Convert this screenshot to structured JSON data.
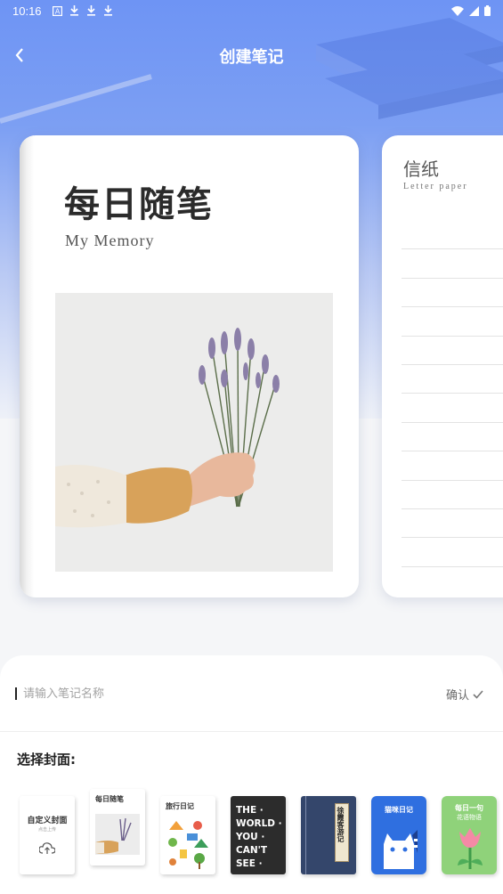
{
  "status_bar": {
    "time": "10:16",
    "left_icons": [
      "font-icon",
      "download-icon",
      "download-icon",
      "download-icon"
    ],
    "right_icons": [
      "wifi-icon",
      "signal-icon",
      "battery-icon"
    ]
  },
  "nav": {
    "title": "创建笔记",
    "back_icon": "chevron-left-icon"
  },
  "carousel": {
    "main_card": {
      "title": "每日随笔",
      "subtitle": "My Memory",
      "image": "lavender-bouquet-photo"
    },
    "letter_card": {
      "title": "信纸",
      "subtitle": "Letter paper"
    }
  },
  "form": {
    "name_placeholder": "请输入笔记名称",
    "name_value": "",
    "confirm_label": "确认",
    "confirm_icon": "checkmark-icon",
    "cover_label": "选择封面:"
  },
  "covers": [
    {
      "name": "custom",
      "line1": "自定义封面",
      "line2": "点击上传"
    },
    {
      "name": "daily-essay",
      "line1": "每日随笔"
    },
    {
      "name": "travel",
      "line1": "旅行日记"
    },
    {
      "name": "the-world",
      "line1": "THE ·",
      "line2": "WORLD ·",
      "line3": "YOU ·",
      "line4": "CAN'T",
      "line5": "SEE ·"
    },
    {
      "name": "ancient",
      "line1": "徐霞客游记"
    },
    {
      "name": "cat",
      "line1": "猫咪日记"
    },
    {
      "name": "flower",
      "line1": "每日一句",
      "line2": "花语物语"
    }
  ],
  "colors": {
    "hero_top": "#6e94f4",
    "panel_bg": "#ffffff",
    "page_bg": "#f5f6f8"
  }
}
